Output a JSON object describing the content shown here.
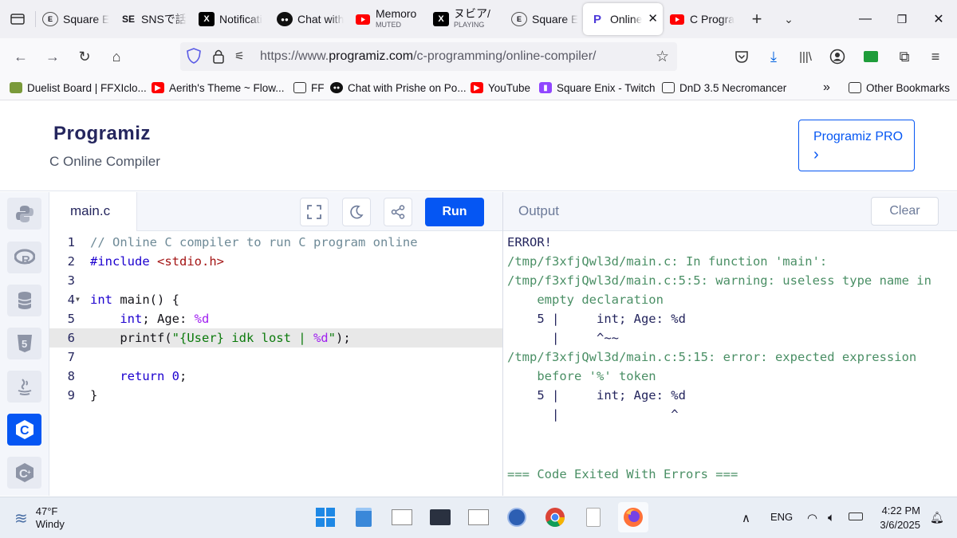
{
  "browser": {
    "tabs": [
      {
        "icon": "square-enix-icon",
        "label": "Square E",
        "sub": ""
      },
      {
        "icon": "se-icon",
        "label": "SNSで話",
        "sub": ""
      },
      {
        "icon": "x-icon",
        "label": "Notificati",
        "sub": ""
      },
      {
        "icon": "chat-icon",
        "label": "Chat with",
        "sub": ""
      },
      {
        "icon": "youtube-icon",
        "label": "Memoro",
        "sub": "MUTED"
      },
      {
        "icon": "x-icon",
        "label": "ヌビア/",
        "sub": "PLAYING"
      },
      {
        "icon": "square-enix-icon",
        "label": "Square E",
        "sub": ""
      },
      {
        "icon": "programiz-icon",
        "label": "Online",
        "sub": ""
      },
      {
        "icon": "youtube-icon",
        "label": "C Progra",
        "sub": ""
      }
    ],
    "url_prefix": "https://www.",
    "url_domain": "programiz.com",
    "url_path": "/c-programming/online-compiler/",
    "bookmarks": [
      {
        "icon": "duelist-icon",
        "label": "Duelist Board | FFXIclo..."
      },
      {
        "icon": "youtube-icon",
        "label": "Aerith's Theme ~ Flow..."
      },
      {
        "icon": "folder-icon",
        "label": "FF"
      },
      {
        "icon": "chat-icon",
        "label": "Chat with Prishe on Po..."
      },
      {
        "icon": "youtube-icon",
        "label": "YouTube"
      },
      {
        "icon": "twitch-icon",
        "label": "Square Enix - Twitch"
      },
      {
        "icon": "folder-icon",
        "label": "DnD 3.5 Necromancer"
      },
      {
        "icon": "folder-icon",
        "label": "Other Bookmarks"
      }
    ]
  },
  "site": {
    "logo": "Programiz",
    "subtitle": "C Online Compiler",
    "pro_label": "Programiz PRO",
    "pro_arrow": "›"
  },
  "editor": {
    "file_tab": "main.c",
    "run_label": "Run",
    "lines": [
      {
        "n": "1",
        "text": "// Online C compiler to run C program online"
      },
      {
        "n": "2",
        "text": "#include <stdio.h>"
      },
      {
        "n": "3",
        "text": ""
      },
      {
        "n": "4",
        "text": "int main() {"
      },
      {
        "n": "5",
        "text": "    int; Age: %d"
      },
      {
        "n": "6",
        "text": "    printf(\"{User} idk lost | %d\");"
      },
      {
        "n": "7",
        "text": ""
      },
      {
        "n": "8",
        "text": "    return 0;"
      },
      {
        "n": "9",
        "text": "}"
      }
    ]
  },
  "output": {
    "title": "Output",
    "clear_label": "Clear",
    "lines": [
      "ERROR!",
      "/tmp/f3xfjQwl3d/main.c: In function 'main':",
      "/tmp/f3xfjQwl3d/main.c:5:5: warning: useless type name in",
      "    empty declaration",
      "    5 |     int; Age: %d",
      "      |     ^~~",
      "/tmp/f3xfjQwl3d/main.c:5:15: error: expected expression",
      "    before '%' token",
      "    5 |     int; Age: %d",
      "      |               ^",
      "",
      "",
      "=== Code Exited With Errors ==="
    ]
  },
  "taskbar": {
    "temp": "47°F",
    "condition": "Windy",
    "lang": "ENG",
    "time": "4:22 PM",
    "date": "3/6/2025"
  }
}
